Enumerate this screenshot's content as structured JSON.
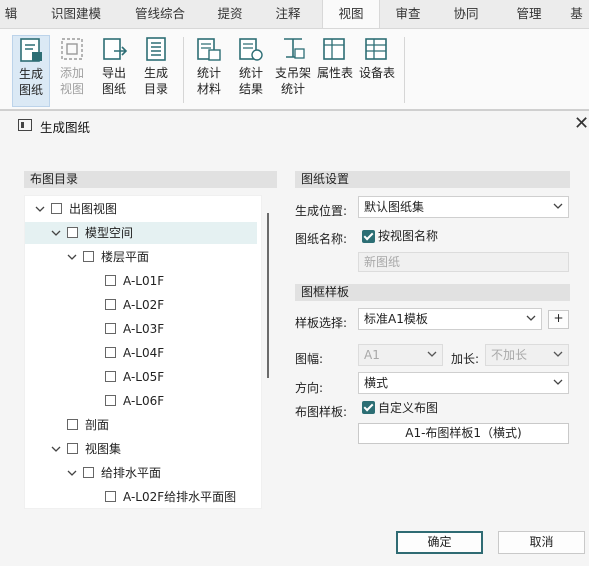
{
  "ribbon": {
    "tabs": [
      "辑",
      "识图建模",
      "管线综合",
      "提资",
      "注释",
      "视图",
      "审查",
      "协同",
      "管理",
      "基"
    ],
    "active_tab": "视图",
    "buttons": [
      {
        "line1": "生成",
        "line2": "图纸",
        "icon": "generate-drawing-icon",
        "state": "selected"
      },
      {
        "line1": "添加",
        "line2": "视图",
        "icon": "add-view-icon",
        "state": "disabled"
      },
      {
        "line1": "导出",
        "line2": "图纸",
        "icon": "export-drawing-icon",
        "state": "normal"
      },
      {
        "line1": "生成",
        "line2": "目录",
        "icon": "generate-catalog-icon",
        "state": "normal"
      },
      {
        "line1": "统计",
        "line2": "材料",
        "icon": "material-stats-icon",
        "state": "normal"
      },
      {
        "line1": "统计",
        "line2": "结果",
        "icon": "result-stats-icon",
        "state": "normal"
      },
      {
        "line1": "支吊架",
        "line2": "统计",
        "icon": "hanger-stats-icon",
        "state": "normal"
      },
      {
        "line1": "属性表",
        "line2": "",
        "icon": "property-table-icon",
        "state": "normal"
      },
      {
        "line1": "设备表",
        "line2": "",
        "icon": "equipment-table-icon",
        "state": "normal"
      }
    ]
  },
  "dialog": {
    "title": "生成图纸",
    "close": "✕",
    "layout_catalog": {
      "header": "布图目录",
      "tree": [
        {
          "label": "出图视图",
          "level": 0,
          "expanded": true,
          "selected": false
        },
        {
          "label": "模型空间",
          "level": 1,
          "expanded": true,
          "selected": true
        },
        {
          "label": "楼层平面",
          "level": 2,
          "expanded": true,
          "selected": false
        },
        {
          "label": "A-L01F",
          "level": 3,
          "expanded": null,
          "selected": false
        },
        {
          "label": "A-L02F",
          "level": 3,
          "expanded": null,
          "selected": false
        },
        {
          "label": "A-L03F",
          "level": 3,
          "expanded": null,
          "selected": false
        },
        {
          "label": "A-L04F",
          "level": 3,
          "expanded": null,
          "selected": false
        },
        {
          "label": "A-L05F",
          "level": 3,
          "expanded": null,
          "selected": false
        },
        {
          "label": "A-L06F",
          "level": 3,
          "expanded": null,
          "selected": false
        },
        {
          "label": "剖面",
          "level": 1,
          "expanded": null,
          "selected": false
        },
        {
          "label": "视图集",
          "level": 1,
          "expanded": true,
          "selected": false
        },
        {
          "label": "给排水平面",
          "level": 2,
          "expanded": true,
          "selected": false
        },
        {
          "label": "A-L02F给排水平面图",
          "level": 3,
          "expanded": null,
          "selected": false
        }
      ]
    },
    "drawing_settings": {
      "header": "图纸设置",
      "location_label": "生成位置:",
      "location_value": "默认图纸集",
      "name_label": "图纸名称:",
      "name_by_view_label": "按视图名称",
      "name_by_view_checked": true,
      "name_value": "新图纸"
    },
    "frame_template": {
      "header": "图框样板",
      "template_label": "样板选择:",
      "template_value": "标准A1模板",
      "add_button": "+",
      "size_label": "图幅:",
      "size_value": "A1",
      "extend_label": "加长:",
      "extend_value": "不加长",
      "direction_label": "方向:",
      "direction_value": "横式",
      "layout_label": "布图样板:",
      "custom_layout_label": "自定义布图",
      "custom_layout_checked": true,
      "layout_button": "A1-布图样板1（横式)"
    },
    "ok_button": "确定",
    "cancel_button": "取消"
  }
}
